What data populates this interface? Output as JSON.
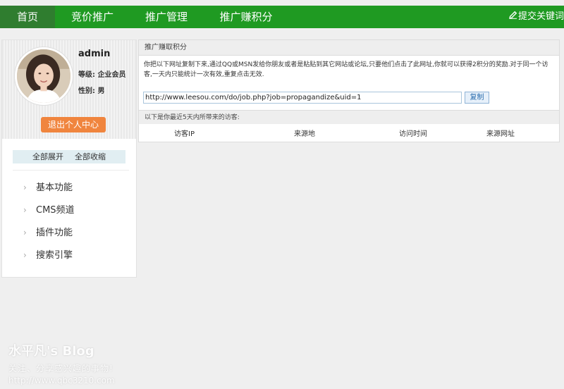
{
  "nav": {
    "home": "首页",
    "bid_promo": "竞价推广",
    "promo_mgmt": "推广管理",
    "promo_points": "推广赚积分",
    "submit_keywords": "提交关键词",
    "active_color": "#2f7d2f",
    "bar_color": "#1f9a22"
  },
  "profile": {
    "username": "admin",
    "level": "等级: 企业会员",
    "gender": "性别: 男",
    "exit_label": "退出个人中心"
  },
  "sidebar": {
    "expand_all": "全部展开",
    "collapse_all": "全部收缩",
    "items": [
      {
        "label": "基本功能",
        "icon": "chevron-right-icon"
      },
      {
        "label": "CMS频道",
        "icon": "chevron-right-icon"
      },
      {
        "label": "插件功能",
        "icon": "chevron-right-icon"
      },
      {
        "label": "搜索引擎",
        "icon": "chevron-right-icon"
      }
    ]
  },
  "main": {
    "panel_title": "推广赚取积分",
    "description": "你把以下网址复制下来,通过QQ或MSN发给你朋友或者是粘贴到其它网站或论坛,只要他们点击了此网址,你就可以获得2积分的奖励.对于同一个访客,一天内只能统计一次有效,重复点击无效.",
    "promo_url": "http://www.leesou.com/do/job.php?job=propagandize&uid=1",
    "copy_label": "复制",
    "visitors_title": "以下是你最近5天内所带来的访客:",
    "columns": [
      "访客IP",
      "来源地",
      "访问时间",
      "来源网址"
    ]
  },
  "watermark": {
    "title": "水平凡's Blog",
    "subtitle": "关注、分享感兴趣的事物!",
    "url": "http://www.qbc3210.com"
  }
}
